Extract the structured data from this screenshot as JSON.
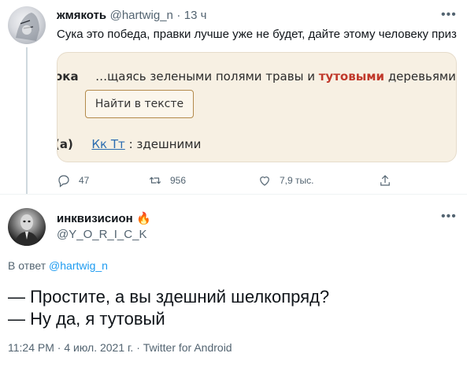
{
  "tweet1": {
    "author_name": "жмякоть",
    "author_handle": "@hartwig_n",
    "time_sep": "·",
    "time": "13 ч",
    "text": "Сука это победа, правки лучше уже не будет, дайте этому человеку приз",
    "media": {
      "prefix": "ока",
      "snippet_pre": "…щаясь зелеными полями травы и ",
      "snippet_highlight": "тутовыми",
      "snippet_post": " деревьями, г",
      "button_label": "Найти в тексте",
      "bottom_label_part1": "(а)",
      "bottom_link": "Кк Тт",
      "bottom_sep": ":",
      "bottom_word": "здешними"
    },
    "actions": {
      "reply_count": "47",
      "retweet_count": "956",
      "like_count": "7,9 тыс."
    },
    "more_icon": "more-dots-icon"
  },
  "tweet2": {
    "author_name": "инквизисион",
    "author_emoji": "🔥",
    "author_handle": "@Y_O_R_I_C_K",
    "reply_prefix": "В ответ",
    "reply_to": "@hartwig_n",
    "line1": "— Простите, а вы здешний шелкопряд?",
    "line2": "— Ну да, я тутовый",
    "meta_time": "11:24 PM",
    "meta_sep1": "·",
    "meta_date": "4 июл. 2021 г.",
    "meta_sep2": "·",
    "meta_source": "Twitter for Android",
    "more_icon": "more-dots-icon"
  },
  "colors": {
    "accent": "#1d9bf0",
    "muted": "#536471",
    "highlight_red": "#c0392b",
    "media_bg": "#f7f0e3"
  }
}
